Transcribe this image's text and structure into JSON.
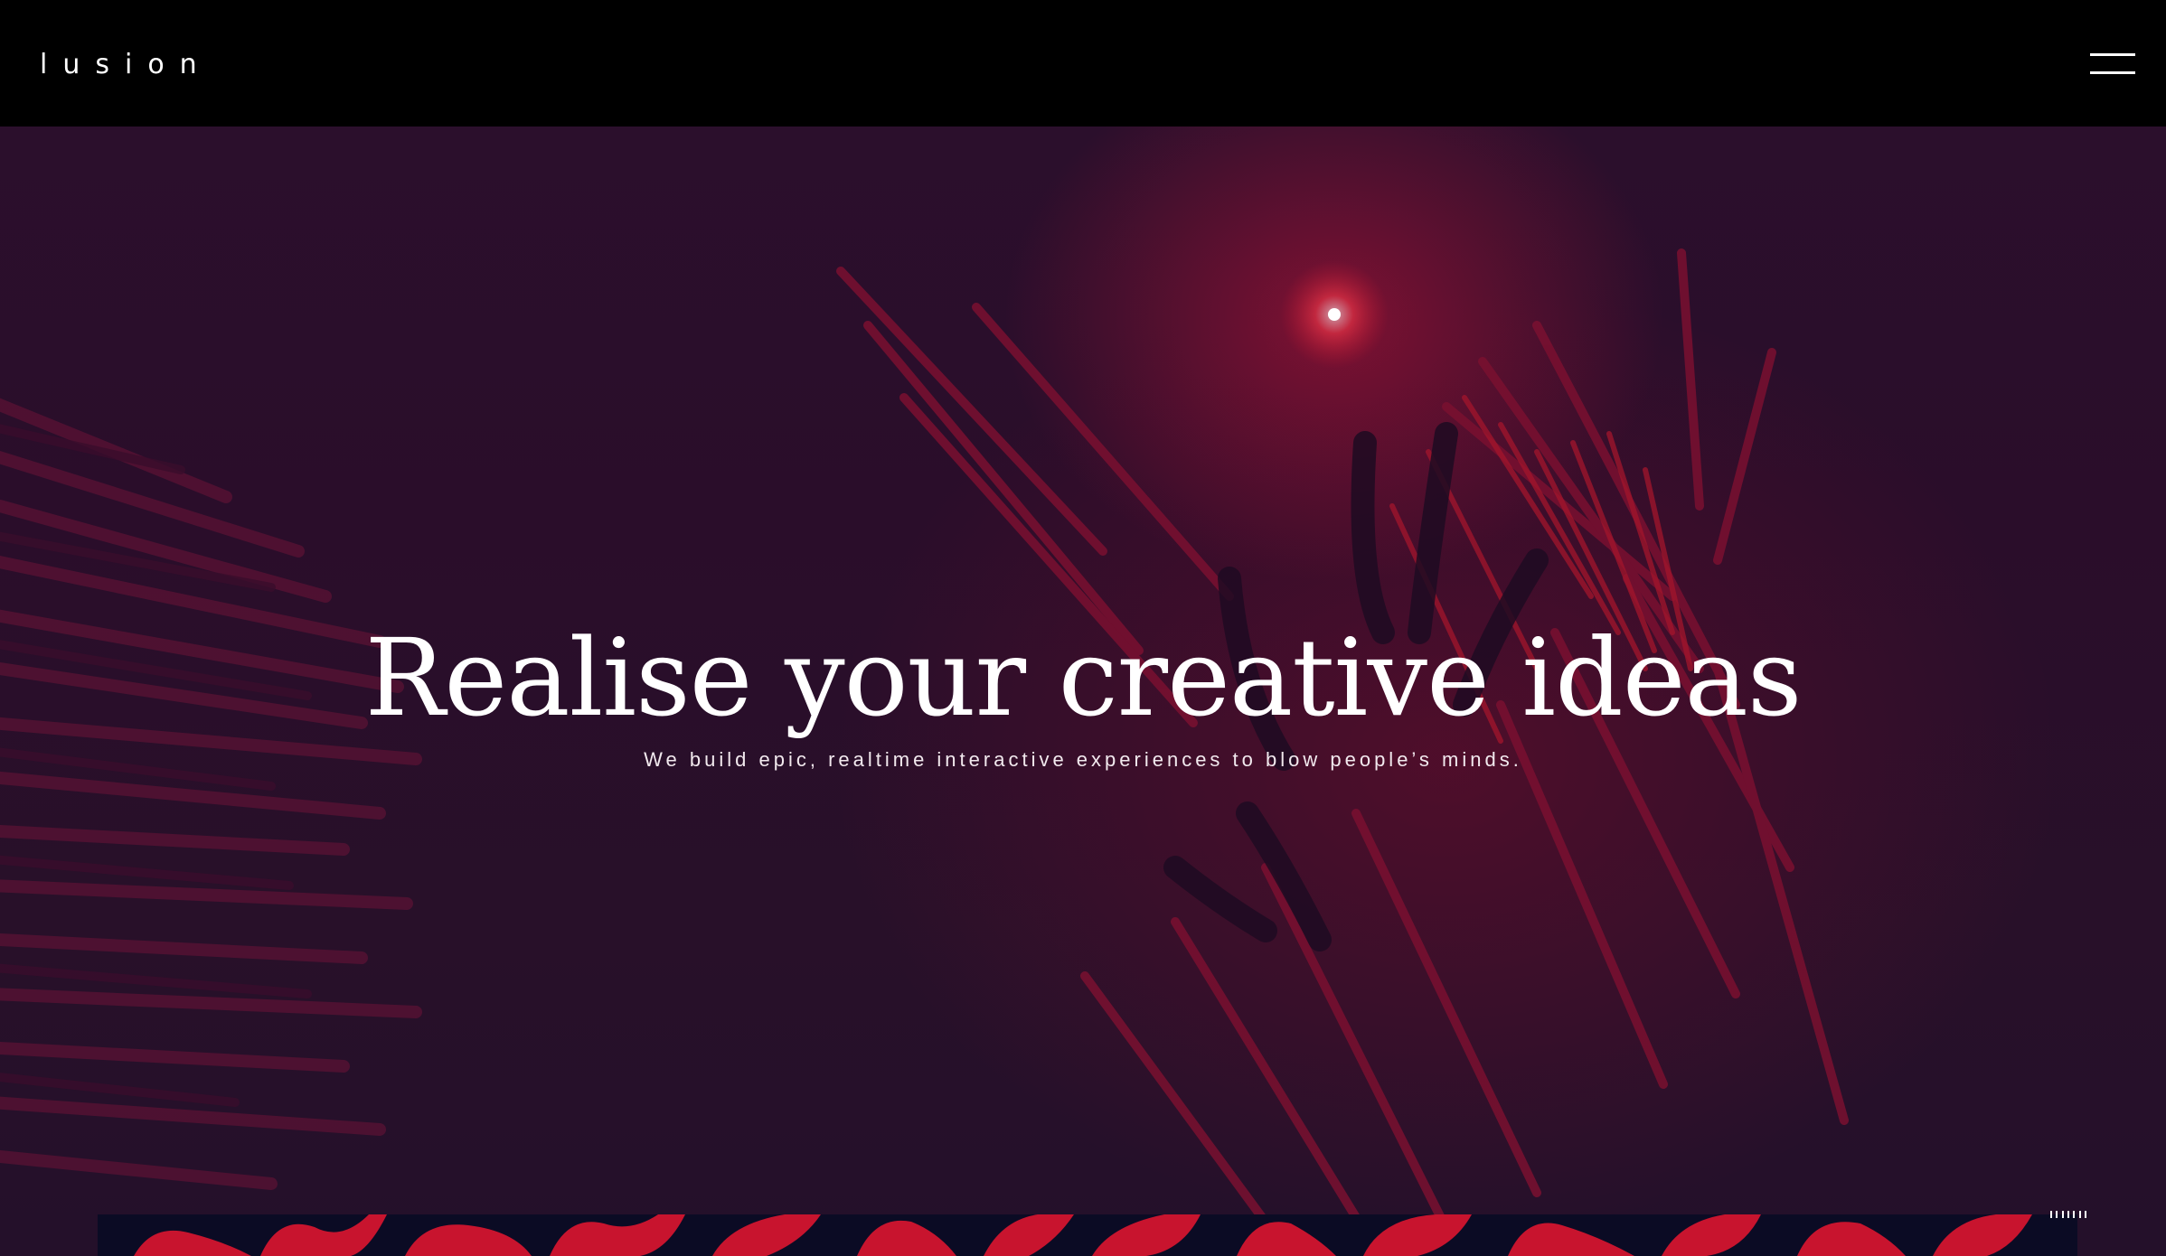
{
  "header": {
    "logo_text": "lusion",
    "menu_icon": "hamburger-menu-icon"
  },
  "hero": {
    "title": "Realise your creative ideas",
    "subtitle": "We build epic, realtime interactive experiences to blow people’s minds."
  },
  "colors": {
    "background": "#000000",
    "hero_bg": "#2a0d2a",
    "accent_red": "#c8142e",
    "text": "#ffffff",
    "strip_bg": "#0b0b24"
  }
}
